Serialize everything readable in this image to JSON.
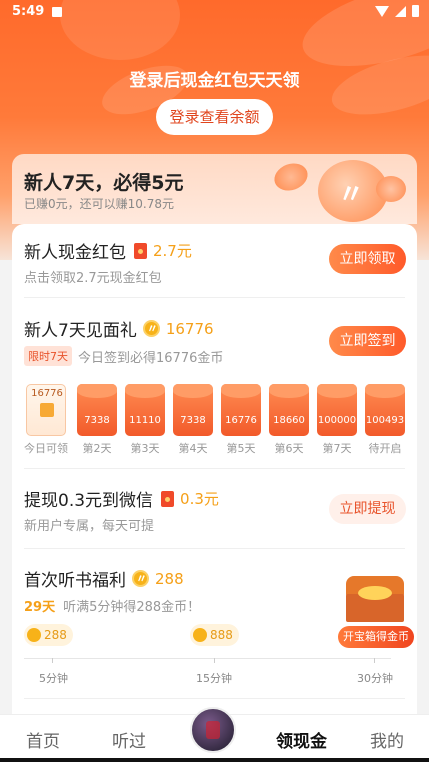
{
  "status_bar": {
    "time": "5:49"
  },
  "hero": {
    "title": "登录后现金红包天天领",
    "login_button": "登录查看余额"
  },
  "newbie_banner": {
    "title": "新人7天，必得5元",
    "subtitle": "已赚0元，还可以赚10.78元"
  },
  "tasks": {
    "cash_red_packet": {
      "title": "新人现金红包",
      "reward": "2.7元",
      "desc": "点击领取2.7元现金红包",
      "button": "立即领取"
    },
    "seven_day_gift": {
      "title": "新人7天见面礼",
      "reward": "16776",
      "tag": "限时7天",
      "desc": "今日签到必得16776金币",
      "button": "立即签到",
      "days": [
        {
          "value": "16776",
          "label": "今日可领"
        },
        {
          "value": "7338",
          "label": "第2天"
        },
        {
          "value": "11110",
          "label": "第3天"
        },
        {
          "value": "7338",
          "label": "第4天"
        },
        {
          "value": "16776",
          "label": "第5天"
        },
        {
          "value": "18660",
          "label": "第6天"
        },
        {
          "value": "100000",
          "label": "第7天"
        },
        {
          "value": "100493",
          "label": "待开启"
        }
      ]
    },
    "withdraw": {
      "title": "提现0.3元到微信",
      "reward": "0.3元",
      "desc": "新用户专属，每天可提",
      "button": "立即提现"
    },
    "first_listen": {
      "title": "首次听书福利",
      "reward": "288",
      "highlight": "29天",
      "desc": "听满5分钟得288金币！",
      "milestones": [
        {
          "coins": "288",
          "label": "5分钟"
        },
        {
          "coins": "888",
          "label": "15分钟"
        },
        {
          "coins": "",
          "label": "30分钟"
        }
      ],
      "treasure_button": "开宝箱得金币"
    }
  },
  "tabbar": {
    "items": [
      "首页",
      "听过",
      "领现金",
      "我的"
    ],
    "active": "领现金"
  }
}
